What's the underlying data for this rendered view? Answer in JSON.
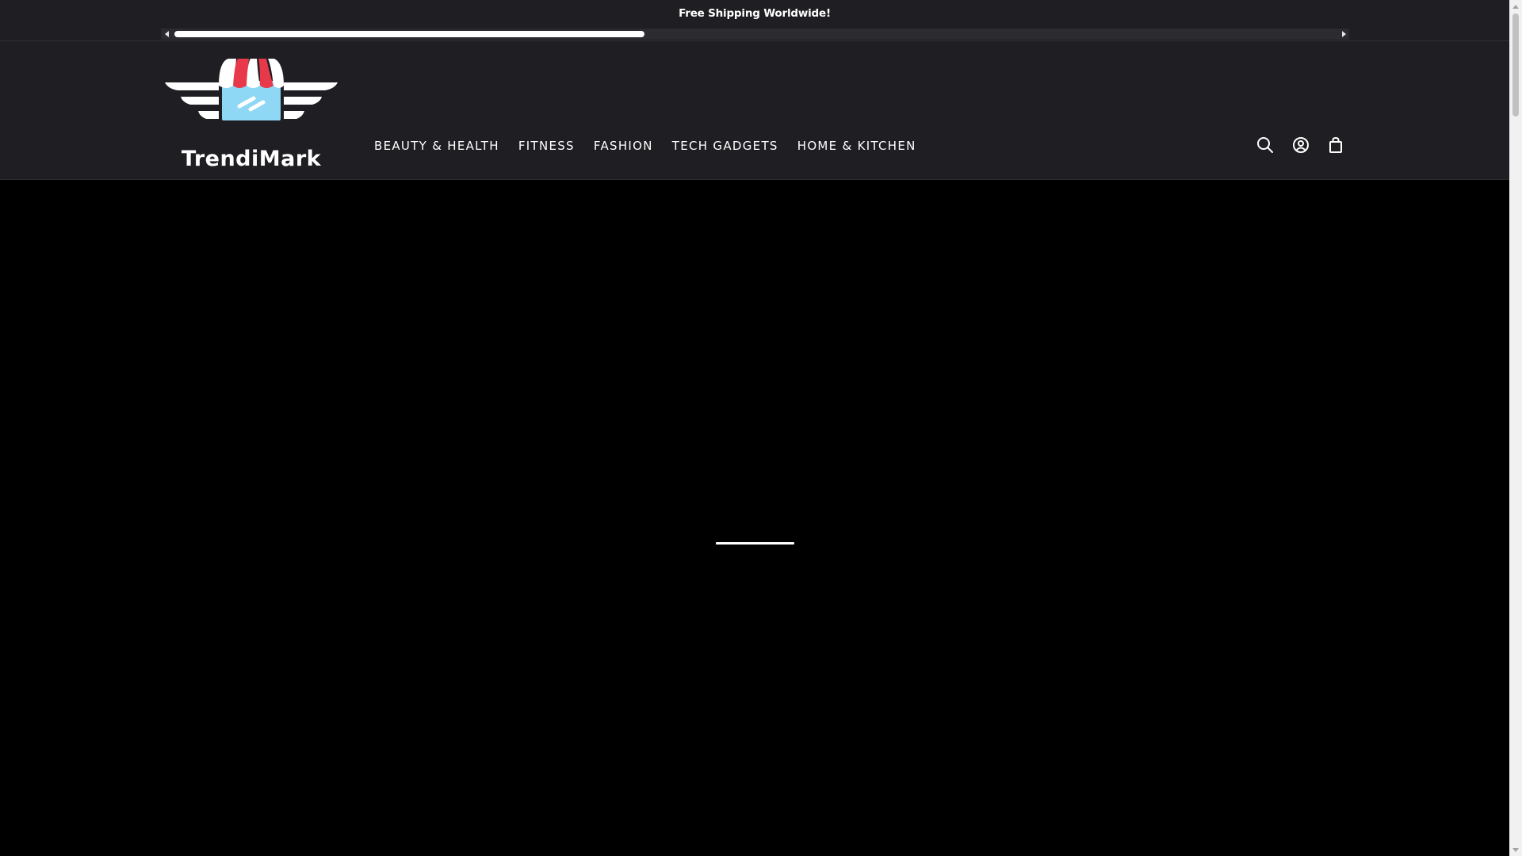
{
  "announcement": {
    "text": "Free Shipping Worldwide!",
    "scroll_progress": 0.405
  },
  "logo": {
    "text": "TrendiMark",
    "icon": "storefront-wings-logo"
  },
  "nav": {
    "items": [
      {
        "label": "BEAUTY & HEALTH"
      },
      {
        "label": "FITNESS"
      },
      {
        "label": "FASHION"
      },
      {
        "label": "TECH GADGETS"
      },
      {
        "label": "HOME & KITCHEN"
      }
    ]
  },
  "header_icons": {
    "search": "search-icon",
    "account": "account-icon",
    "cart": "shopping-bag-icon"
  },
  "colors": {
    "header_bg": "#1e1e23",
    "hero_bg": "#000000",
    "awning_red": "#e8394a",
    "awning_white": "#ffffff",
    "store_blue": "#8fd8f5"
  },
  "page_scroll_progress": 0.0
}
